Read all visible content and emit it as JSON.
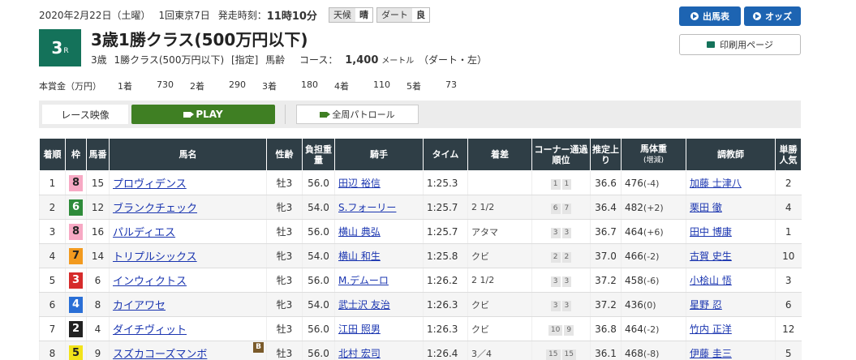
{
  "header": {
    "date": "2020年2月22日（土曜）",
    "meeting": "1回東京7日",
    "post_time_label": "発走時刻：",
    "post_time": "11時10分",
    "weather_label": "天候",
    "weather": "晴",
    "track_label": "ダート",
    "track_cond": "良"
  },
  "race": {
    "number": "3",
    "r": "R",
    "title": "3歳1勝クラス(500万円以下)",
    "sub_age": "3歳",
    "sub_class": "1勝クラス(500万円以下)",
    "sub_cond": "[指定]",
    "sub_weight": "馬齢",
    "course_label": "コース：",
    "distance": "1,400",
    "unit": "メートル",
    "course_type": "（ダート・左）"
  },
  "prize": {
    "label": "本賞金（万円）",
    "items": [
      {
        "rank": "1着",
        "value": "730"
      },
      {
        "rank": "2着",
        "value": "290"
      },
      {
        "rank": "3着",
        "value": "180"
      },
      {
        "rank": "4着",
        "value": "110"
      },
      {
        "rank": "5着",
        "value": "73"
      }
    ]
  },
  "buttons": {
    "entries": "出馬表",
    "odds": "オッズ",
    "print": "印刷用ページ"
  },
  "video": {
    "label": "レース映像",
    "play": "PLAY",
    "patrol": "全周パトロール"
  },
  "table": {
    "headers": {
      "rank": "着順",
      "waku": "枠",
      "num": "馬番",
      "horse": "馬名",
      "sex": "性齢",
      "weight": "負担重量",
      "jockey": "騎手",
      "time": "タイム",
      "diff": "着差",
      "corner": "コーナー通過順位",
      "last3f": "推定上り",
      "bodyweight": "馬体重",
      "bodyweight_sub": "(増減)",
      "trainer": "調教師",
      "pop": "単勝人気"
    },
    "rows": [
      {
        "rank": "1",
        "waku": "8",
        "num": "15",
        "horse": "プロヴィデンス",
        "sex": "牡3",
        "wt": "56.0",
        "jockey": "田辺 裕信",
        "time": "1:25.3",
        "diff": "",
        "c1": "1",
        "c2": "1",
        "last": "36.6",
        "bw": "476",
        "bwd": "(-4)",
        "trainer": "加藤 士津八",
        "pop": "2",
        "badge": ""
      },
      {
        "rank": "2",
        "waku": "6",
        "num": "12",
        "horse": "ブランクチェック",
        "sex": "牝3",
        "wt": "54.0",
        "jockey": "S.フォーリー",
        "time": "1:25.7",
        "diff": "2 1/2",
        "c1": "6",
        "c2": "7",
        "last": "36.4",
        "bw": "482",
        "bwd": "(+2)",
        "trainer": "栗田 徹",
        "pop": "4",
        "badge": ""
      },
      {
        "rank": "3",
        "waku": "8",
        "num": "16",
        "horse": "パルディエス",
        "sex": "牡3",
        "wt": "56.0",
        "jockey": "横山 典弘",
        "time": "1:25.7",
        "diff": "アタマ",
        "c1": "3",
        "c2": "3",
        "last": "36.7",
        "bw": "464",
        "bwd": "(+6)",
        "trainer": "田中 博康",
        "pop": "1",
        "badge": ""
      },
      {
        "rank": "4",
        "waku": "7",
        "num": "14",
        "horse": "トリプルシックス",
        "sex": "牝3",
        "wt": "54.0",
        "jockey": "横山 和生",
        "time": "1:25.8",
        "diff": "クビ",
        "c1": "2",
        "c2": "2",
        "last": "37.0",
        "bw": "466",
        "bwd": "(-2)",
        "trainer": "古賀 史生",
        "pop": "10",
        "badge": ""
      },
      {
        "rank": "5",
        "waku": "3",
        "num": "6",
        "horse": "インウィクトス",
        "sex": "牝3",
        "wt": "56.0",
        "jockey": "M.デムーロ",
        "time": "1:26.2",
        "diff": "2 1/2",
        "c1": "3",
        "c2": "3",
        "last": "37.2",
        "bw": "458",
        "bwd": "(-6)",
        "trainer": "小桧山 悟",
        "pop": "3",
        "badge": ""
      },
      {
        "rank": "6",
        "waku": "4",
        "num": "8",
        "horse": "カイアワセ",
        "sex": "牝3",
        "wt": "54.0",
        "jockey": "武士沢 友治",
        "time": "1:26.3",
        "diff": "クビ",
        "c1": "3",
        "c2": "3",
        "last": "37.2",
        "bw": "436",
        "bwd": "(0)",
        "trainer": "星野 忍",
        "pop": "6",
        "badge": ""
      },
      {
        "rank": "7",
        "waku": "2",
        "num": "4",
        "horse": "ダイチヴィット",
        "sex": "牡3",
        "wt": "56.0",
        "jockey": "江田 照男",
        "time": "1:26.3",
        "diff": "クビ",
        "c1": "10",
        "c2": "9",
        "last": "36.8",
        "bw": "464",
        "bwd": "(-2)",
        "trainer": "竹内 正洋",
        "pop": "12",
        "badge": ""
      },
      {
        "rank": "8",
        "waku": "5",
        "num": "9",
        "horse": "スズカコーズマンボ",
        "sex": "牡3",
        "wt": "56.0",
        "jockey": "北村 宏司",
        "time": "1:26.4",
        "diff": "3／4",
        "c1": "15",
        "c2": "15",
        "last": "36.1",
        "bw": "468",
        "bwd": "(-8)",
        "trainer": "伊藤 圭三",
        "pop": "5",
        "badge": "B"
      }
    ]
  },
  "colors": {
    "waku1": "#ffffff",
    "waku2": "#222222",
    "waku3": "#d62b2b",
    "waku4": "#2a6fd6",
    "waku5": "#f2e31a",
    "waku6": "#2e8b3a",
    "waku7": "#f29a1f",
    "waku8": "#f7a9c4",
    "race_badge": "#14725a",
    "header_bg": "#2f3e46",
    "button_blue": "#1d64b2",
    "play_green": "#3f7f23"
  }
}
